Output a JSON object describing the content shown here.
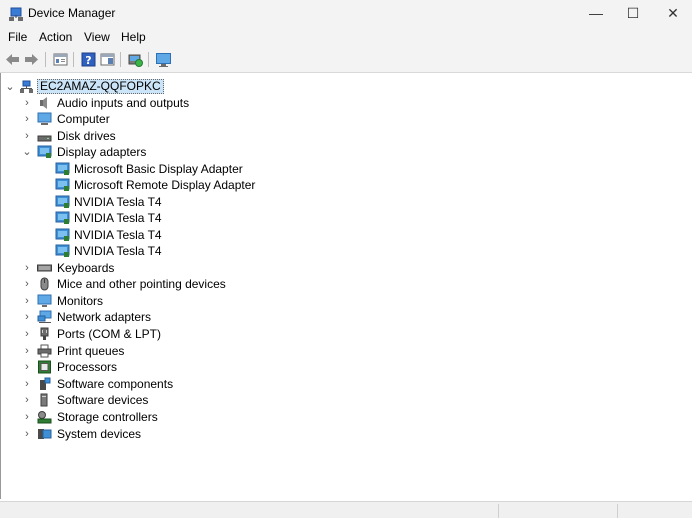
{
  "window": {
    "title": "Device Manager",
    "minimize": "—",
    "maximize": "☐",
    "close": "✕"
  },
  "menu": [
    "File",
    "Action",
    "View",
    "Help"
  ],
  "toolbar_icons": [
    "back-arrow-icon",
    "forward-arrow-icon",
    "properties-icon",
    "help-icon",
    "view-icon",
    "scan-hardware-icon",
    "monitor-icon"
  ],
  "tree": {
    "root": "EC2AMAZ-QQFOPKC",
    "categories": [
      {
        "label": "Audio inputs and outputs",
        "icon": "speaker-icon",
        "expanded": false
      },
      {
        "label": "Computer",
        "icon": "computer-icon",
        "expanded": false
      },
      {
        "label": "Disk drives",
        "icon": "disk-drive-icon",
        "expanded": false
      },
      {
        "label": "Display adapters",
        "icon": "display-adapter-icon",
        "expanded": true,
        "children": [
          "Microsoft Basic Display Adapter",
          "Microsoft Remote Display Adapter",
          "NVIDIA Tesla T4",
          "NVIDIA Tesla T4",
          "NVIDIA Tesla T4",
          "NVIDIA Tesla T4"
        ]
      },
      {
        "label": "Keyboards",
        "icon": "keyboard-icon",
        "expanded": false
      },
      {
        "label": "Mice and other pointing devices",
        "icon": "mouse-icon",
        "expanded": false
      },
      {
        "label": "Monitors",
        "icon": "monitor-icon",
        "expanded": false
      },
      {
        "label": "Network adapters",
        "icon": "network-icon",
        "expanded": false
      },
      {
        "label": "Ports (COM & LPT)",
        "icon": "port-icon",
        "expanded": false
      },
      {
        "label": "Print queues",
        "icon": "printer-icon",
        "expanded": false
      },
      {
        "label": "Processors",
        "icon": "processor-icon",
        "expanded": false
      },
      {
        "label": "Software components",
        "icon": "software-component-icon",
        "expanded": false
      },
      {
        "label": "Software devices",
        "icon": "software-device-icon",
        "expanded": false
      },
      {
        "label": "Storage controllers",
        "icon": "storage-controller-icon",
        "expanded": false
      },
      {
        "label": "System devices",
        "icon": "system-devices-icon",
        "expanded": false
      }
    ]
  },
  "colors": {
    "selection": "#cce4f7",
    "chrome": "#f3f3f3"
  }
}
